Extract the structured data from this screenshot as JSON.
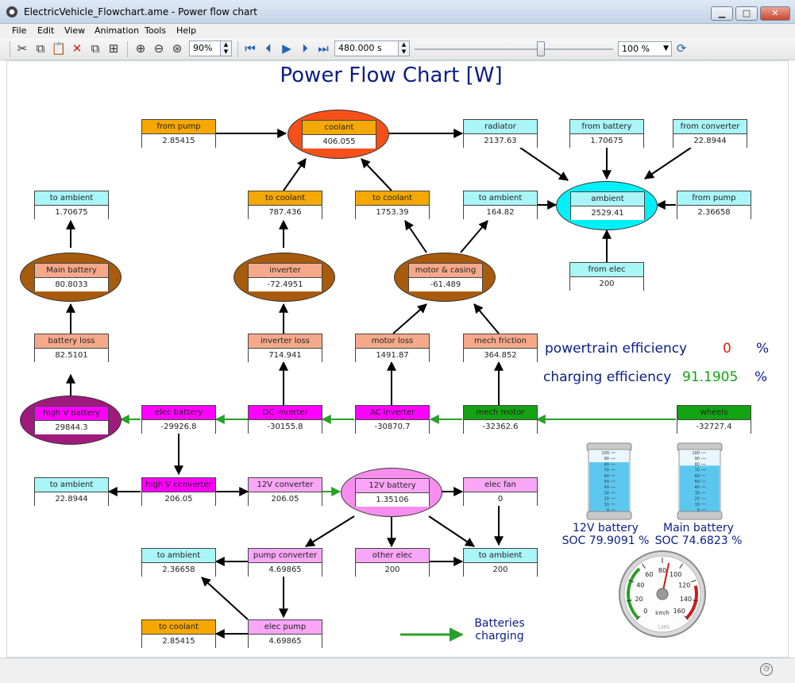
{
  "window": {
    "title": "ElectricVehicle_Flowchart.ame - Power flow chart",
    "minimize": "▁",
    "maximize": "□",
    "close": "✕"
  },
  "menu": [
    "File",
    "Edit",
    "View",
    "Animation",
    "Tools",
    "Help"
  ],
  "toolbar": {
    "zoom_value": "90%",
    "time_value": "480.000 s",
    "speed_value": "100 %",
    "icons": [
      "cut-icon",
      "copy-icon",
      "paste-icon",
      "delete-icon",
      "duplicate-icon",
      "group-icon",
      "zoom-in-icon",
      "zoom-out-icon",
      "zoom-fit-icon",
      "first-frame-icon",
      "step-back-icon",
      "play-icon",
      "step-forward-icon",
      "last-frame-icon",
      "loop-icon"
    ]
  },
  "chart": {
    "title": "Power Flow Chart [W]"
  },
  "colors": {
    "orange": "#f5a800",
    "cyan_light": "#aaf5f7",
    "salmon": "#f5a98a",
    "magenta": "#ff00ff",
    "pink_light": "#f8a6f5",
    "green": "#13a313",
    "brown": "#a75b0c",
    "coolant_red": "#f6501a",
    "ambient_cyan": "#00f0f8",
    "purple": "#a01a7d",
    "title_blue": "#0a1d85",
    "arrow_green": "#2aa02a"
  },
  "nodes": {
    "from_pump_top": {
      "label": "from pump",
      "value": "2.85415"
    },
    "coolant": {
      "label": "coolant",
      "value": "406.055"
    },
    "radiator": {
      "label": "radiator",
      "value": "2137.63"
    },
    "from_battery": {
      "label": "from battery",
      "value": "1.70675"
    },
    "from_converter": {
      "label": "from converter",
      "value": "22.8944"
    },
    "to_ambient_batt": {
      "label": "to ambient",
      "value": "1.70675"
    },
    "to_coolant_inv": {
      "label": "to coolant",
      "value": "787.436"
    },
    "to_coolant_motor": {
      "label": "to coolant",
      "value": "1753.39"
    },
    "to_ambient_motor": {
      "label": "to ambient",
      "value": "164.82"
    },
    "ambient": {
      "label": "ambient",
      "value": "2529.41"
    },
    "from_pump_amb": {
      "label": "from pump",
      "value": "2.36658"
    },
    "main_battery": {
      "label": "Main battery",
      "value": "80.8033"
    },
    "inverter": {
      "label": "inverter",
      "value": "-72.4951"
    },
    "motor_casing": {
      "label": "motor & casing",
      "value": "-61.489"
    },
    "from_elec": {
      "label": "from elec",
      "value": "200"
    },
    "battery_loss": {
      "label": "battery loss",
      "value": "82.5101"
    },
    "inverter_loss": {
      "label": "inverter loss",
      "value": "714.941"
    },
    "motor_loss": {
      "label": "motor loss",
      "value": "1491.87"
    },
    "mech_friction": {
      "label": "mech friction",
      "value": "364.852"
    },
    "high_v_battery": {
      "label": "high V battery",
      "value": "29844.3"
    },
    "elec_battery": {
      "label": "elec battery",
      "value": "-29926.8"
    },
    "dc_inverter": {
      "label": "DC inverter",
      "value": "-30155.8"
    },
    "ac_inverter": {
      "label": "AC inverter",
      "value": "-30870.7"
    },
    "mech_motor": {
      "label": "mech motor",
      "value": "-32362.6"
    },
    "wheels": {
      "label": "wheels",
      "value": "-32727.4"
    },
    "to_ambient_hv": {
      "label": "to ambient",
      "value": "22.8944"
    },
    "high_v_converter": {
      "label": "high V converter",
      "value": "206.05"
    },
    "v12_converter": {
      "label": "12V converter",
      "value": "206.05"
    },
    "v12_battery": {
      "label": "12V battery",
      "value": "1.35106"
    },
    "elec_fan": {
      "label": "elec fan",
      "value": "0"
    },
    "to_ambient_pump": {
      "label": "to ambient",
      "value": "2.36658"
    },
    "pump_converter": {
      "label": "pump converter",
      "value": "4.69865"
    },
    "other_elec": {
      "label": "other elec",
      "value": "200"
    },
    "to_ambient_12v": {
      "label": "to ambient",
      "value": "200"
    },
    "to_coolant_pump": {
      "label": "to coolant",
      "value": "2.85415"
    },
    "elec_pump": {
      "label": "elec pump",
      "value": "4.69865"
    }
  },
  "efficiency": {
    "powertrain_label": "powertrain efficiency",
    "powertrain_value": "0",
    "powertrain_unit": "%",
    "charging_label": "charging efficiency",
    "charging_value": "91.1905",
    "charging_unit": "%"
  },
  "batteries": {
    "v12": {
      "name": "12V battery",
      "soc": "SOC 79.9091 %",
      "level": 0.799
    },
    "main": {
      "name": "Main battery",
      "soc": "SOC 74.6823 %",
      "level": 0.747
    },
    "scale": [
      "100",
      "90",
      "80",
      "70",
      "60",
      "50",
      "40",
      "30",
      "20",
      "10",
      "0"
    ]
  },
  "gauge": {
    "ticks": [
      "0",
      "20",
      "40",
      "60",
      "80",
      "100",
      "120",
      "140",
      "160"
    ],
    "unit": "km/h",
    "brand": "LMS",
    "speed": 87
  },
  "legend": {
    "text_line1": "Batteries",
    "text_line2": "charging"
  }
}
